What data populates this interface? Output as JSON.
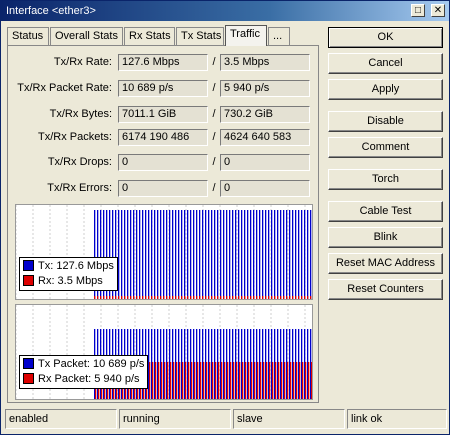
{
  "window": {
    "title": "Interface <ether3>",
    "maximize_glyph": "□",
    "close_glyph": "✕"
  },
  "tabs": [
    {
      "label": "Status"
    },
    {
      "label": "Overall Stats"
    },
    {
      "label": "Rx Stats"
    },
    {
      "label": "Tx Stats"
    },
    {
      "label": "Traffic",
      "active": true
    },
    {
      "label": "..."
    }
  ],
  "stats": [
    {
      "label": "Tx/Rx Rate:",
      "tx": "127.6 Mbps",
      "rx": "3.5 Mbps"
    },
    {
      "label": "Tx/Rx Packet Rate:",
      "tx": "10 689 p/s",
      "rx": "5 940 p/s"
    },
    {
      "label": "Tx/Rx Bytes:",
      "tx": "7011.1 GiB",
      "rx": "730.2 GiB"
    },
    {
      "label": "Tx/Rx Packets:",
      "tx": "6174 190 486",
      "rx": "4624 640 583"
    },
    {
      "label": "Tx/Rx Drops:",
      "tx": "0",
      "rx": "0"
    },
    {
      "label": "Tx/Rx Errors:",
      "tx": "0",
      "rx": "0"
    }
  ],
  "separator": "/",
  "graphs": {
    "traffic": {
      "legend": [
        {
          "label": "Tx:  127.6 Mbps",
          "color": "#0000cc"
        },
        {
          "label": "Rx:  3.5 Mbps",
          "color": "#dd0000"
        }
      ]
    },
    "packets": {
      "legend": [
        {
          "label": "Tx Packet:  10 689 p/s",
          "color": "#0000cc"
        },
        {
          "label": "Rx Packet:  5 940 p/s",
          "color": "#dd0000"
        }
      ]
    }
  },
  "buttons": {
    "ok": "OK",
    "cancel": "Cancel",
    "apply": "Apply",
    "disable": "Disable",
    "comment": "Comment",
    "torch": "Torch",
    "cable_test": "Cable Test",
    "blink": "Blink",
    "reset_mac": "Reset MAC Address",
    "reset_counters": "Reset Counters"
  },
  "status": {
    "state": "enabled",
    "running": "running",
    "role": "slave",
    "link": "link ok"
  }
}
